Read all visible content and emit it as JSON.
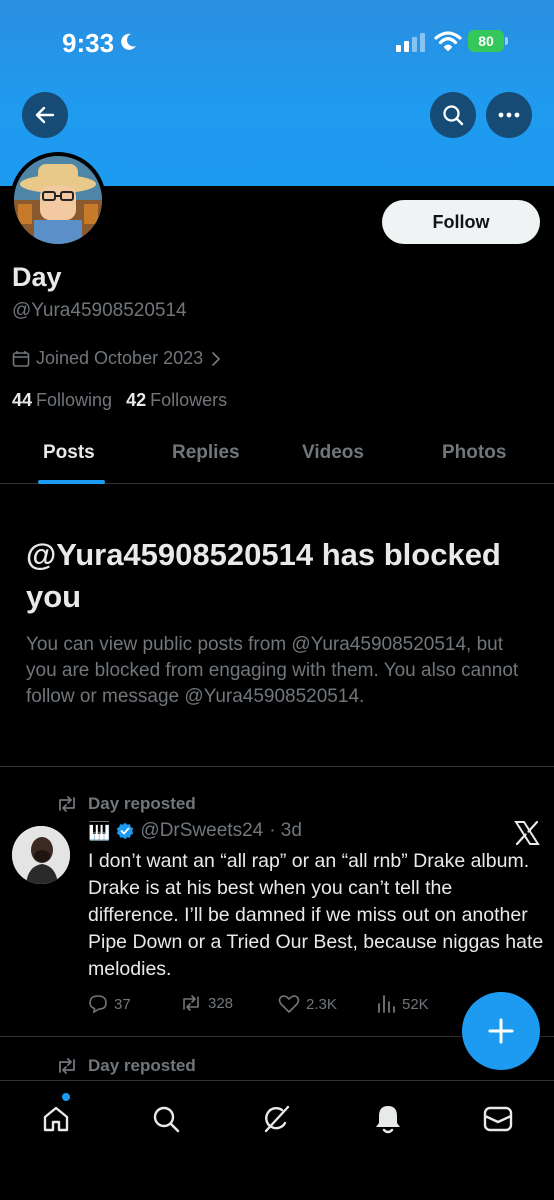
{
  "status_bar": {
    "time": "9:33",
    "battery": "80"
  },
  "profile": {
    "name": "Day",
    "handle": "@Yura45908520514",
    "joined": "Joined October 2023",
    "following_count": "44",
    "following_label": "Following",
    "followers_count": "42",
    "followers_label": "Followers",
    "follow_label": "Follow"
  },
  "tabs": [
    "Posts",
    "Replies",
    "Videos",
    "Photos"
  ],
  "blocked": {
    "title": "@Yura45908520514 has blocked you",
    "body": "You can view public posts from @Yura45908520514, but you are blocked from engaging with them. You also cannot follow or message @Yura45908520514."
  },
  "tweet": {
    "repost_label": "Day reposted",
    "author_prefix": "🎹",
    "author_handle": "@DrSweets24",
    "time": "· 3d",
    "text": "I don’t want an “all rap” or an “all rnb” Drake album. Drake is at his best when you can’t tell the difference. I’ll be damned if we miss out on another Pipe Down or a Tried Our Best, because niggas hate melodies.",
    "replies": "37",
    "reposts": "328",
    "likes": "2.3K",
    "views": "52K"
  },
  "next_repost_label": "Day reposted",
  "colors": {
    "accent": "#1d9bf0",
    "banner": "#1d9bf0",
    "muted": "#71767b",
    "text": "#e7e9ea"
  },
  "icons": [
    "back-arrow-icon",
    "search-icon",
    "more-icon",
    "calendar-icon",
    "chevron-right-icon",
    "repost-icon",
    "verified-icon",
    "x-logo-icon",
    "reply-icon",
    "like-icon",
    "views-icon",
    "plus-icon",
    "home-icon",
    "explore-icon",
    "grok-icon",
    "notifications-icon",
    "messages-icon"
  ]
}
